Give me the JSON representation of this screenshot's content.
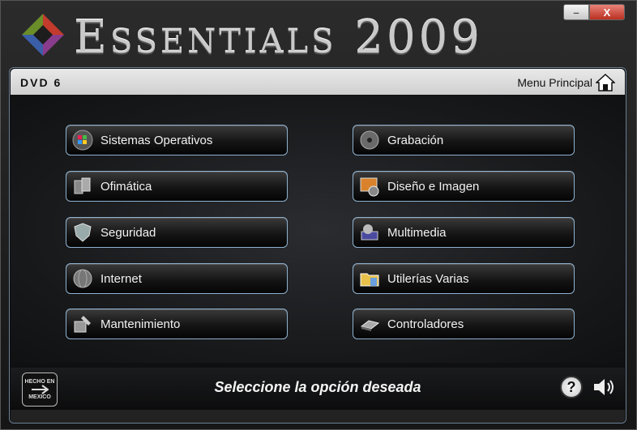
{
  "window": {
    "title_first": "E",
    "title_rest": "SSENTIALS",
    "title_year": "2009",
    "minimize_glyph": "–",
    "close_glyph": "X"
  },
  "header": {
    "dvd_label": "DVD 6",
    "menu_link_label": "Menu Principal",
    "home_icon": "home-icon"
  },
  "menu": {
    "left": [
      {
        "label": "Sistemas Operativos",
        "icon": "windows-icon"
      },
      {
        "label": "Ofimática",
        "icon": "office-icon"
      },
      {
        "label": "Seguridad",
        "icon": "shield-icon"
      },
      {
        "label": "Internet",
        "icon": "globe-icon"
      },
      {
        "label": "Mantenimiento",
        "icon": "tools-icon"
      }
    ],
    "right": [
      {
        "label": "Grabación",
        "icon": "disc-icon"
      },
      {
        "label": "Diseño e Imagen",
        "icon": "picture-icon"
      },
      {
        "label": "Multimedia",
        "icon": "media-icon"
      },
      {
        "label": "Utilerías Varias",
        "icon": "folder-icon"
      },
      {
        "label": "Controladores",
        "icon": "hardware-icon"
      }
    ]
  },
  "footer": {
    "badge_line1": "HECHO EN",
    "badge_line2": "MEXICO",
    "status": "Seleccione la opción deseada",
    "help_glyph": "?"
  },
  "colors": {
    "button_border": "#8fb2d0",
    "panel_border": "#6a7f94",
    "close_red": "#b9301f"
  }
}
